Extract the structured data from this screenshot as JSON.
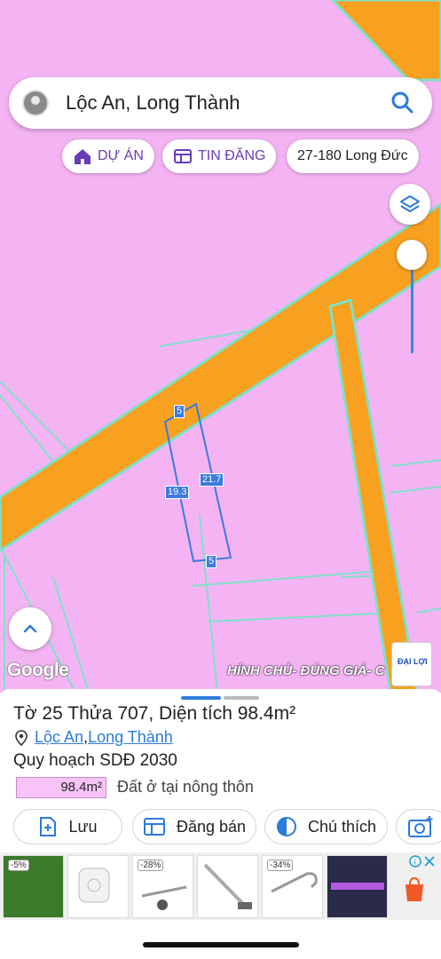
{
  "search": {
    "text": "Lộc An, Long Thành"
  },
  "chips": [
    {
      "label": "DỰ ÁN",
      "icon": "home-icon"
    },
    {
      "label": "TIN ĐĂNG",
      "icon": "listing-icon"
    },
    {
      "label": "27-180 Long Đức"
    }
  ],
  "map": {
    "dims": {
      "top": "5",
      "right": "21.7",
      "left": "19.3",
      "bottom": "5"
    },
    "attribution": "Google",
    "ad_banner": "HÍNH CHỦ- ĐÚNG GIÁ- C",
    "ad_logo_text": "ĐẠI LỢI"
  },
  "sheet": {
    "title": "Tờ 25 Thửa 707, Diện tích 98.4m²",
    "commune": "Lộc An",
    "district": "Long Thành",
    "separator": ", ",
    "plan": "Quy hoạch SDĐ 2030",
    "area_value": "98.4m²",
    "area_desc": "Đất ở tại nông thôn",
    "actions": [
      {
        "label": "Lưu",
        "icon": "save-add-icon"
      },
      {
        "label": "Đăng bán",
        "icon": "post-listing-icon"
      },
      {
        "label": "Chú thích",
        "icon": "legend-icon"
      }
    ]
  },
  "ads": {
    "badges": [
      "-5%",
      "-28%",
      "-34%"
    ]
  },
  "colors": {
    "land": "#f4b4f4",
    "road": "#f8a020",
    "accent": "#2b7bd8",
    "chip_text": "#6a3bb5"
  }
}
